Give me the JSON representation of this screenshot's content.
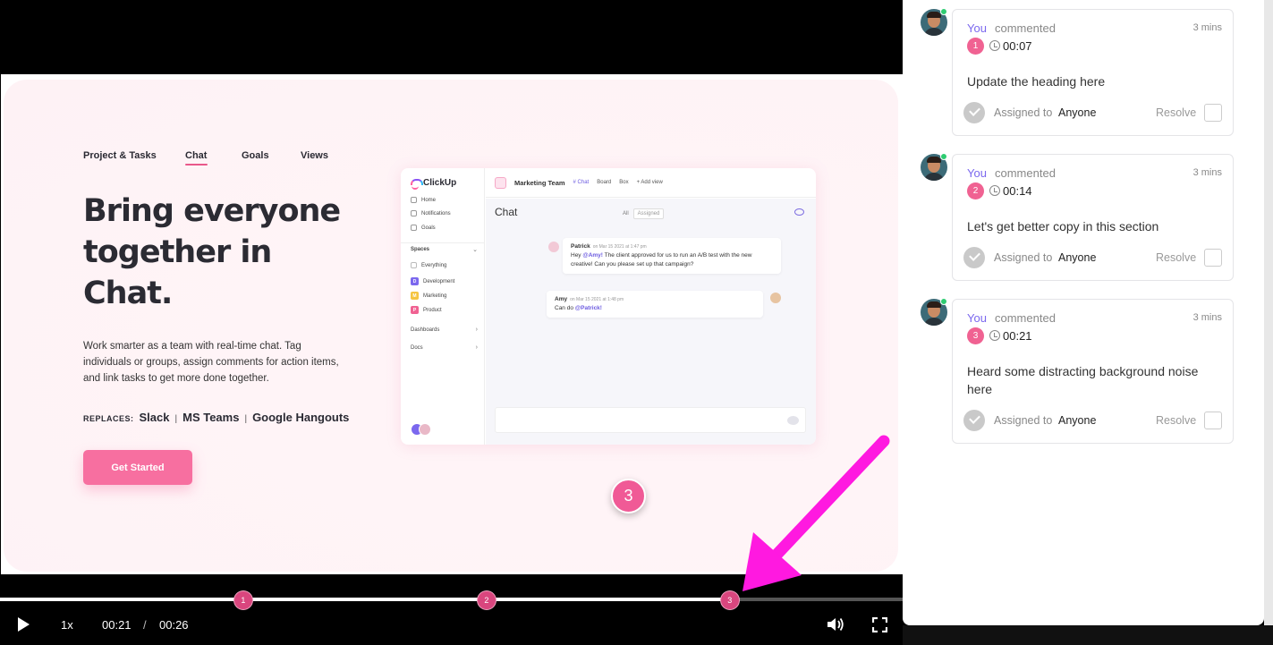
{
  "video": {
    "nav": [
      "Project & Tasks",
      "Chat",
      "Goals",
      "Views"
    ],
    "heading": "Bring everyone together in Chat.",
    "body_text": "Work smarter as a team with real-time chat. Tag individuals or groups, assign comments for action items, and link tasks to get more done together.",
    "replaces_label": "REPLACES:",
    "replaces_apps": [
      "Slack",
      "MS Teams",
      "Google Hangouts"
    ],
    "cta": "Get Started",
    "app": {
      "logo": "ClickUp",
      "sidebar": [
        "Home",
        "Notifications",
        "Goals"
      ],
      "spaces_label": "Spaces",
      "spaces": [
        {
          "label": "Everything",
          "badge": "",
          "color": "#999999"
        },
        {
          "label": "Development",
          "badge": "D",
          "color": "#7b68ee"
        },
        {
          "label": "Marketing",
          "badge": "M",
          "color": "#f5c542"
        },
        {
          "label": "Product",
          "badge": "P",
          "color": "#f06292"
        }
      ],
      "dashboards": "Dashboards",
      "docs": "Docs",
      "team": "Marketing Team",
      "tabs": [
        "# Chat",
        "Board",
        "Box",
        "+ Add view"
      ],
      "chat_title": "Chat",
      "filter_all": "All",
      "filter_assigned": "Assigned",
      "messages": [
        {
          "who": "Patrick",
          "when": "on Mar 15 2021 at 1:47 pm",
          "pre": "Hey ",
          "mention": "@Amy!",
          "post": " The client approved for us to run an A/B test with the new creative! Can you please set up that campaign?"
        },
        {
          "who": "Amy",
          "when": "on Mar 15 2021 at 1:48 pm",
          "pre": "Can do ",
          "mention": "@Patrick!",
          "post": ""
        }
      ]
    },
    "overlay_marker": "3",
    "markers": [
      "1",
      "2",
      "3"
    ],
    "progress": 0.81,
    "speed": "1x",
    "current_time": "00:21",
    "time_sep": "/",
    "duration": "00:26",
    "accent": "#f05a96",
    "arrow_color": "#ff19e0"
  },
  "comments": [
    {
      "author": "You",
      "verb": "commented",
      "age": "3 mins",
      "number": "1",
      "timestamp": "00:07",
      "text": "Update the heading here",
      "assigned_label": "Assigned to",
      "assignee": "Anyone",
      "resolve": "Resolve"
    },
    {
      "author": "You",
      "verb": "commented",
      "age": "3 mins",
      "number": "2",
      "timestamp": "00:14",
      "text": "Let's get better copy in this section",
      "assigned_label": "Assigned to",
      "assignee": "Anyone",
      "resolve": "Resolve"
    },
    {
      "author": "You",
      "verb": "commented",
      "age": "3 mins",
      "number": "3",
      "timestamp": "00:21",
      "text": "Heard some distracting background noise here",
      "assigned_label": "Assigned to",
      "assignee": "Anyone",
      "resolve": "Resolve"
    }
  ]
}
